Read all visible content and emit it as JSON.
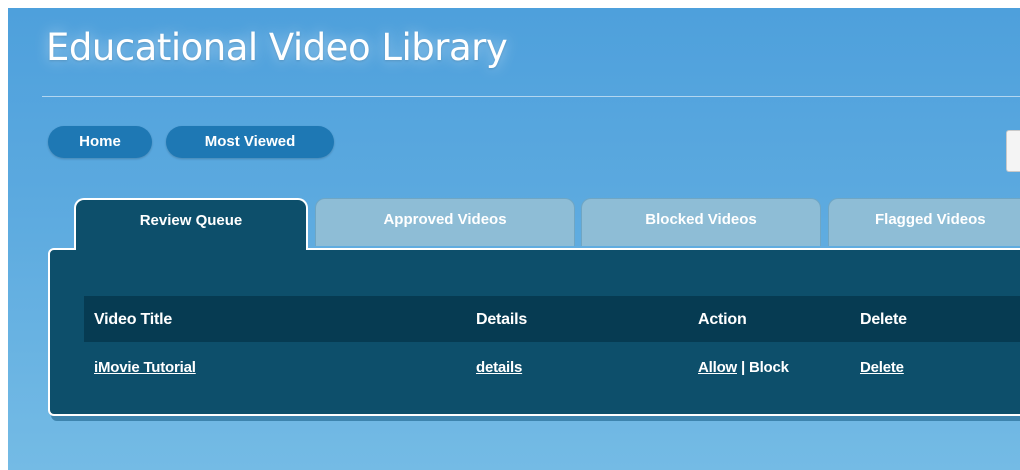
{
  "header": {
    "title": "Educational Video Library"
  },
  "nav": {
    "home": "Home",
    "most_viewed": "Most Viewed"
  },
  "tabs": [
    {
      "label": "Review Queue",
      "active": true
    },
    {
      "label": "Approved Videos",
      "active": false
    },
    {
      "label": "Blocked Videos",
      "active": false
    },
    {
      "label": "Flagged Videos",
      "active": false
    }
  ],
  "table": {
    "columns": [
      "Video Title",
      "Details",
      "Action",
      "Delete"
    ],
    "rows": [
      {
        "title": "iMovie Tutorial",
        "details": "details",
        "allow": "Allow",
        "separator": " | ",
        "block": "Block",
        "delete": "Delete"
      }
    ]
  },
  "colors": {
    "background": "#5ba9df",
    "nav_button": "#1e78b4",
    "panel": "#0d4f6b",
    "table_header": "#063b52",
    "inactive_tab": "#8ebdd6"
  }
}
